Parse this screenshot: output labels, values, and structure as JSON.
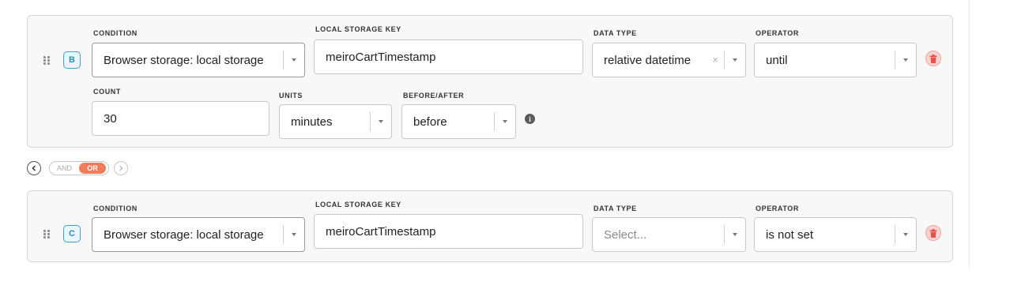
{
  "conditions": [
    {
      "badge": "B",
      "labels": {
        "condition": "CONDITION",
        "storage_key": "LOCAL STORAGE KEY",
        "data_type": "DATA TYPE",
        "operator": "OPERATOR",
        "count": "COUNT",
        "units": "UNITS",
        "before_after": "BEFORE/AFTER"
      },
      "condition": "Browser storage: local storage",
      "storage_key": "meiroCartTimestamp",
      "data_type": "relative datetime",
      "data_type_clear": "×",
      "operator": "until",
      "count": "30",
      "units": "minutes",
      "before_after": "before"
    },
    {
      "badge": "C",
      "labels": {
        "condition": "CONDITION",
        "storage_key": "LOCAL STORAGE KEY",
        "data_type": "DATA TYPE",
        "operator": "OPERATOR"
      },
      "condition": "Browser storage: local storage",
      "storage_key": "meiroCartTimestamp",
      "data_type_placeholder": "Select...",
      "operator": "is not set"
    }
  ],
  "connector": {
    "and_label": "AND",
    "or_label": "OR",
    "active": "OR"
  },
  "icons": {
    "info_glyph": "i",
    "colors": {
      "badge_border": "#3aa3c7",
      "or_active": "#f07c5a",
      "trash_bg": "#f9d3d1",
      "trash_icon": "#e2534b"
    }
  }
}
